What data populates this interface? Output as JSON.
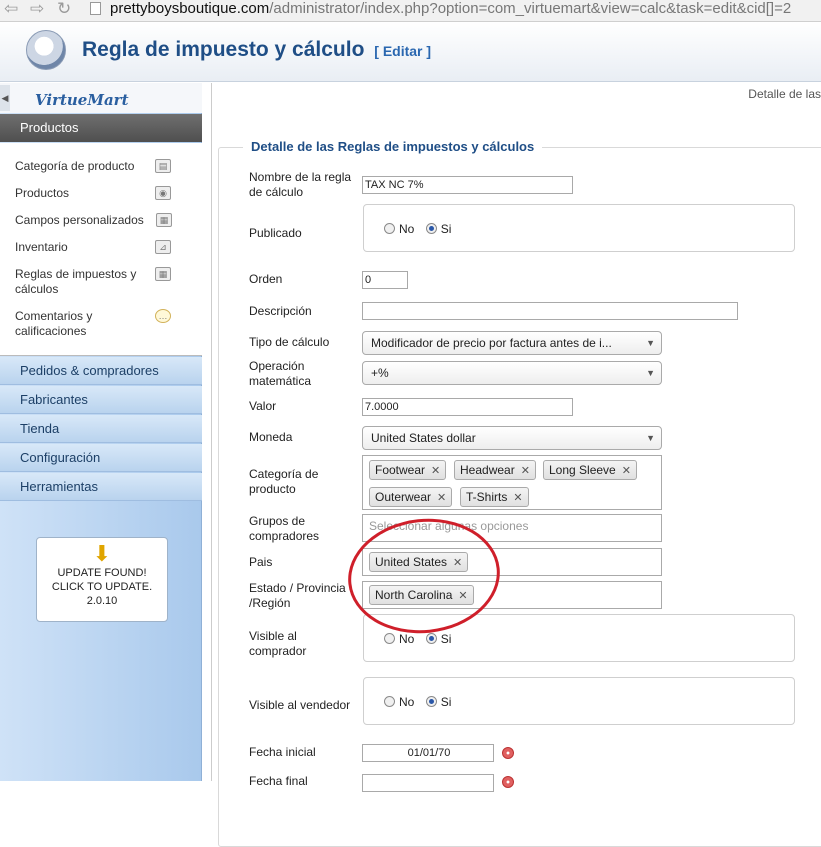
{
  "browser": {
    "url_host": "prettyboysboutique.com",
    "url_path": "/administrator/index.php?option=com_virtuemart&view=calc&task=edit&cid[]=2"
  },
  "header": {
    "title": "Regla de impuesto y cálculo",
    "edit_label": "[ Editar ]"
  },
  "sidebar": {
    "logo_text": "VirtueMart",
    "active_section": "Productos",
    "items": [
      {
        "label": "Categoría de producto"
      },
      {
        "label": "Productos"
      },
      {
        "label": "Campos personalizados"
      },
      {
        "label": "Inventario"
      },
      {
        "label": "Reglas de impuestos y cálculos"
      },
      {
        "label": "Comentarios y calificaciones"
      }
    ],
    "sections": [
      "Pedidos & compradores",
      "Fabricantes",
      "Tienda",
      "Configuración",
      "Herramientas"
    ],
    "update": {
      "message": "UPDATE FOUND! CLICK TO UPDATE.",
      "version": "2.0.10"
    }
  },
  "content": {
    "breadcrumb": "Detalle de las",
    "legend": "Detalle de las Reglas de impuestos y cálculos",
    "fields": {
      "name": {
        "label": "Nombre de la regla de cálculo",
        "value": "TAX NC 7%"
      },
      "published": {
        "label": "Publicado",
        "no": "No",
        "yes": "Si"
      },
      "order": {
        "label": "Orden",
        "value": "0"
      },
      "description": {
        "label": "Descripción",
        "value": ""
      },
      "calc_type": {
        "label": "Tipo de cálculo",
        "value": "Modificador de precio por factura antes de i..."
      },
      "operation": {
        "label": "Operación matemática",
        "value": "+%"
      },
      "value": {
        "label": "Valor",
        "value": "7.0000"
      },
      "currency": {
        "label": "Moneda",
        "value": "United States dollar"
      },
      "categories": {
        "label": "Categoría de producto",
        "chips": [
          "Footwear",
          "Headwear",
          "Long Sleeve",
          "Outerwear",
          "T-Shirts"
        ]
      },
      "shopper_groups": {
        "label": "Grupos de compradores",
        "placeholder": "Seleccionar algunas opciones"
      },
      "country": {
        "label": "Pais",
        "chips": [
          "United States"
        ]
      },
      "state": {
        "label": "Estado / Provincia /Región",
        "chips": [
          "North Carolina"
        ]
      },
      "visible_buyer": {
        "label": "Visible al comprador",
        "no": "No",
        "yes": "Si"
      },
      "visible_vendor": {
        "label": "Visible al vendedor",
        "no": "No",
        "yes": "Si"
      },
      "start_date": {
        "label": "Fecha inicial",
        "value": "01/01/70"
      },
      "end_date": {
        "label": "Fecha final"
      }
    }
  },
  "colors": {
    "title": "#1f4e86",
    "annotation": "#cf1f2a",
    "sidebar_active": "#5a5a5a"
  }
}
